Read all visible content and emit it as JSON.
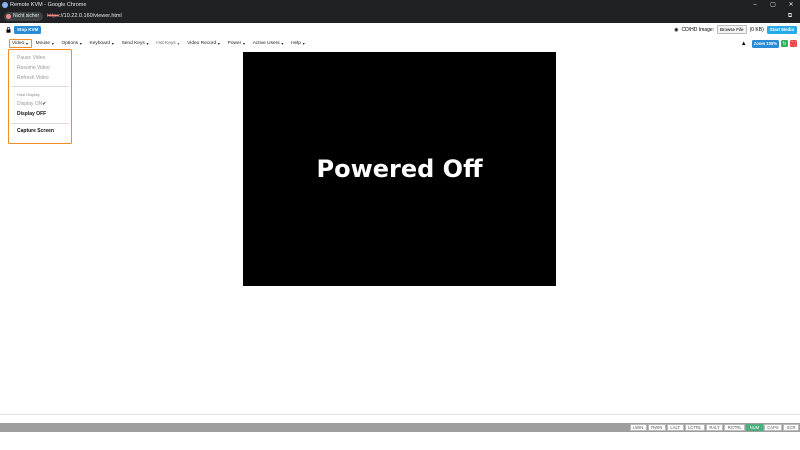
{
  "window": {
    "title": "Remote KVM - Google Chrome"
  },
  "window_controls": [
    "–",
    "▢",
    "✕"
  ],
  "address": {
    "security_label": "Nicht sicher",
    "protocol": "https",
    "rest": "://10.22.0.160/viewer.html"
  },
  "toolbar": {
    "stop_kvm": "Stop KVM",
    "cd_label": "CD/HD Image:",
    "browse_file": "Browse File",
    "file_size": "(0 KB)",
    "start_media": "Start Media"
  },
  "menu": {
    "items": [
      {
        "label": "Video"
      },
      {
        "label": "Mouse"
      },
      {
        "label": "Options"
      },
      {
        "label": "Keyboard"
      },
      {
        "label": "Send Keys"
      },
      {
        "label": "Hot Keys"
      },
      {
        "label": "Video Record"
      },
      {
        "label": "Power"
      },
      {
        "label": "Active Users"
      },
      {
        "label": "Help"
      }
    ],
    "zoom": "Zoom 100%"
  },
  "video_menu": {
    "pause": "Pause Video",
    "resume": "Resume Video",
    "refresh": "Refresh Video",
    "host_display_header": "Host Display",
    "display_on": "Display ON",
    "display_on_check": "✔",
    "display_off": "Display OFF",
    "capture": "Capture Screen"
  },
  "screen": {
    "message": "Powered Off"
  },
  "status_keys": [
    {
      "label": "LWIN",
      "on": false
    },
    {
      "label": "RWIN",
      "on": false
    },
    {
      "label": "LALT",
      "on": false
    },
    {
      "label": "LCTRL",
      "on": false
    },
    {
      "label": "RALT",
      "on": false
    },
    {
      "label": "RCTRL",
      "on": false
    },
    {
      "label": "NUM",
      "on": true
    },
    {
      "label": "CAPS",
      "on": false
    },
    {
      "label": "SCR",
      "on": false
    }
  ],
  "colors": {
    "accent_blue": "#2b8bd6",
    "menu_highlight": "#f28c28",
    "num_on": "#4caf7d"
  }
}
